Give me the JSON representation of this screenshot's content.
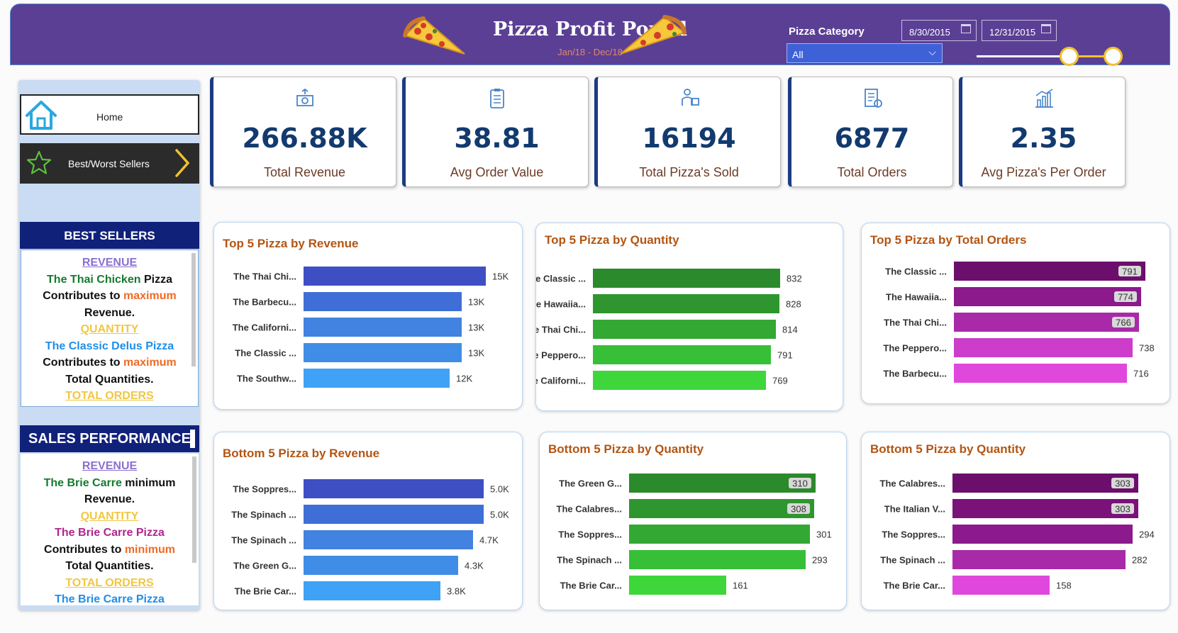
{
  "header": {
    "title": "Pizza Profit Portal",
    "subtitle": "Jan/18 - Dec/18",
    "category_label": "Pizza Category",
    "category_value": "All",
    "date_start": "8/30/2015",
    "date_end": "12/31/2015",
    "colors": {
      "bg": "#5b3f94",
      "select": "#3f61d8",
      "slider": "#f3c12c"
    }
  },
  "nav": {
    "home_label": "Home",
    "best_worst_label": "Best/Worst Sellers"
  },
  "best_sellers": {
    "heading": "BEST SELLERS",
    "revenue_label": "REVENUE",
    "revenue_name": "The Thai Chicken",
    "revenue_word_pizza": "Pizza",
    "contributes_to": "Contributes to",
    "maximum": "maximum",
    "revenue_end": "Revenue.",
    "quantity_label": "QUANTITY",
    "quantity_name": "The Classic Delus Pizza",
    "quantity_end": "Total Quantities.",
    "orders_label": "TOTAL ORDERS"
  },
  "sales_performance": {
    "heading": "SALES PERFORMANCE",
    "revenue_label": "REVENUE",
    "revenue_name": "The Brie Carre",
    "revenue_tail": "minimum",
    "revenue_end": "Revenue.",
    "quantity_label": "QUANTITY",
    "quantity_name": "The Brie Carre Pizza",
    "contributes_to": "Contributes to",
    "minimum": "minimum",
    "quantity_end": "Total Quantities.",
    "orders_label": "TOTAL ORDERS",
    "orders_name": "The Brie Carre Pizza"
  },
  "kpis": [
    {
      "value": "266.88K",
      "label": "Total Revenue",
      "icon": "money-icon"
    },
    {
      "value": "38.81",
      "label": "Avg Order Value",
      "icon": "clipboard-icon"
    },
    {
      "value": "16194",
      "label": "Total Pizza's Sold",
      "icon": "delivery-icon"
    },
    {
      "value": "6877",
      "label": "Total Orders",
      "icon": "order-list-icon"
    },
    {
      "value": "2.35",
      "label": "Avg Pizza's Per Order",
      "icon": "bar-chart-icon"
    }
  ],
  "chart_data": [
    {
      "type": "bar",
      "title": "Top 5 Pizza by Revenue",
      "categories": [
        "The Thai Chi...",
        "The Barbecu...",
        "The Californi...",
        "The Classic ...",
        "The Southw..."
      ],
      "values": [
        15,
        13,
        13,
        13,
        12
      ],
      "value_labels": [
        "15K",
        "13K",
        "13K",
        "13K",
        "12K"
      ],
      "colors": [
        "#3e4fc4",
        "#3f6fd6",
        "#4282e0",
        "#3f8de6",
        "#3fa2f6"
      ]
    },
    {
      "type": "bar",
      "title": "Top 5 Pizza by Quantity",
      "categories": [
        "The Classic ...",
        "The Hawaiia...",
        "The Thai Chi...",
        "The Peppero...",
        "The Californi..."
      ],
      "values": [
        832,
        828,
        814,
        791,
        769
      ],
      "value_labels": [
        "832",
        "828",
        "814",
        "791",
        "769"
      ],
      "colors": [
        "#2b8a2b",
        "#2f962f",
        "#33a833",
        "#38bf38",
        "#3ed63a"
      ]
    },
    {
      "type": "bar",
      "title": "Top 5 Pizza by Total Orders",
      "categories": [
        "The Classic ...",
        "The Hawaiia...",
        "The Thai Chi...",
        "The Peppero...",
        "The Barbecu..."
      ],
      "values": [
        791,
        774,
        766,
        738,
        716
      ],
      "value_labels": [
        "791",
        "774",
        "766",
        "738",
        "716"
      ],
      "colors": [
        "#6c0f6c",
        "#8c1a8c",
        "#a82aa8",
        "#cc3dcc",
        "#e048dd"
      ]
    },
    {
      "type": "bar",
      "title": "Bottom 5 Pizza by Revenue",
      "categories": [
        "The Soppres...",
        "The Spinach ...",
        "The Spinach ...",
        "The Green G...",
        "The Brie Car..."
      ],
      "values": [
        5.0,
        5.0,
        4.7,
        4.3,
        3.8
      ],
      "value_labels": [
        "5.0K",
        "5.0K",
        "4.7K",
        "4.3K",
        "3.8K"
      ],
      "colors": [
        "#3e4fc4",
        "#3f6fd6",
        "#4282e0",
        "#3f8de6",
        "#3fa2f6"
      ]
    },
    {
      "type": "bar",
      "title": "Bottom 5 Pizza by Quantity",
      "categories": [
        "The Green G...",
        "The Calabres...",
        "The Soppres...",
        "The Spinach ...",
        "The Brie Car..."
      ],
      "values": [
        310,
        308,
        301,
        293,
        161
      ],
      "value_labels": [
        "310",
        "308",
        "301",
        "293",
        "161"
      ],
      "colors": [
        "#2b8a2b",
        "#2f962f",
        "#33a833",
        "#38bf38",
        "#3ed63a"
      ]
    },
    {
      "type": "bar",
      "title": "Bottom 5 Pizza by Quantity",
      "categories": [
        "The Calabres...",
        "The Italian V...",
        "The Soppres...",
        "The Spinach ...",
        "The Brie Car..."
      ],
      "values": [
        303,
        303,
        294,
        282,
        158
      ],
      "value_labels": [
        "303",
        "303",
        "294",
        "282",
        "158"
      ],
      "colors": [
        "#6c0f6c",
        "#7a127a",
        "#8c1a8c",
        "#a82aa8",
        "#e048dd"
      ]
    }
  ]
}
